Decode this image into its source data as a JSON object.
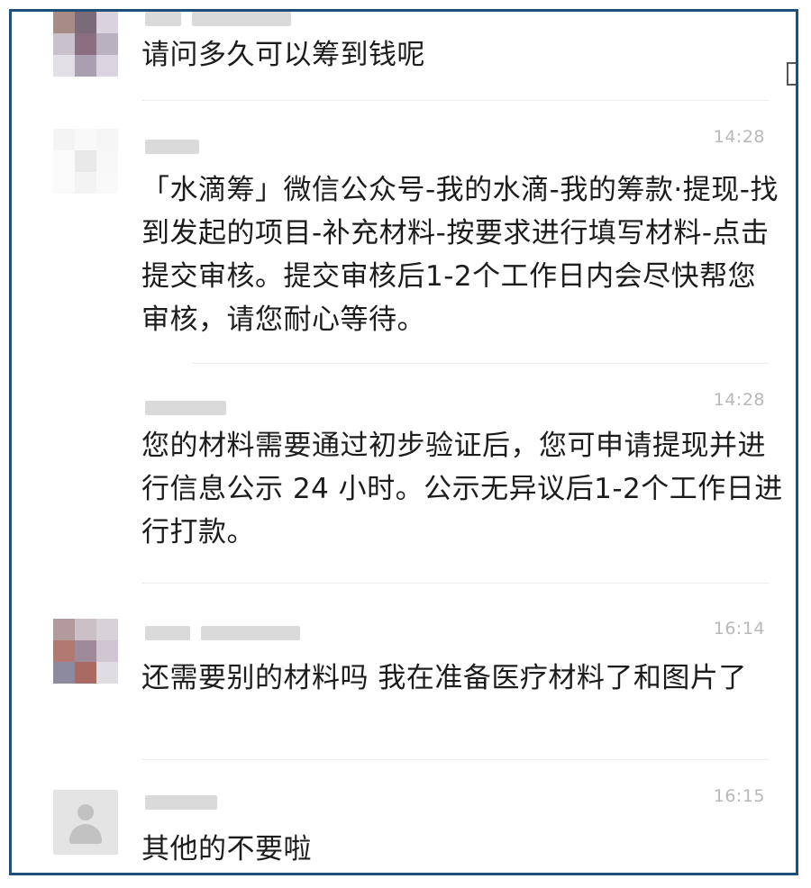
{
  "messages": [
    {
      "id": "msg1",
      "time": "",
      "text": "请问多久可以筹到钱呢"
    },
    {
      "id": "msg2",
      "time": "14:28",
      "text": "「水滴筹」微信公众号-我的水滴-我的筹款·提现-找到发起的项目-补充材料-按要求进行填写材料-点击提交审核。提交审核后1-2个工作日内会尽快帮您审核，请您耐心等待。"
    },
    {
      "id": "msg3",
      "time": "14:28",
      "text": "您的材料需要通过初步验证后，您可申请提现并进行信息公示 24 小时。公示无异议后1-2个工作日进行打款。"
    },
    {
      "id": "msg4",
      "time": "16:14",
      "text": "还需要别的材料吗 我在准备医疗材料了和图片了"
    },
    {
      "id": "msg5",
      "time": "16:15",
      "text": "其他的不要啦"
    }
  ],
  "colors": {
    "frame_border": "#1f4e79",
    "time_text": "#b8b8b8",
    "message_text": "#1c1c1c"
  },
  "icons": {
    "default_avatar": "person-silhouette-icon"
  }
}
